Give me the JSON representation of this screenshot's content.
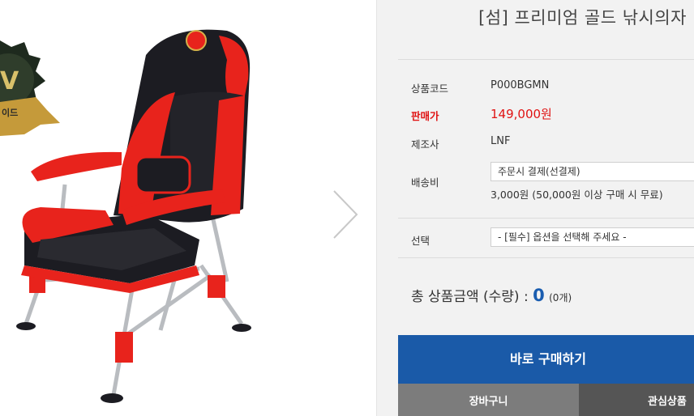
{
  "product": {
    "title": "[섬] 프리미엄 골드 낚시의자",
    "badge_text": "이드"
  },
  "info": {
    "code_label": "상품코드",
    "code_value": "P000BGMN",
    "price_label": "판매가",
    "price_value": "149,000원",
    "maker_label": "제조사",
    "maker_value": "LNF",
    "shipping_label": "배송비",
    "shipping_select": "주문시 결제(선결제)",
    "shipping_note": "3,000원 (50,000원 이상 구매 시 무료)",
    "option_label": "선택",
    "option_select": "- [필수] 옵션을 선택해 주세요 -"
  },
  "total": {
    "label": "총 상품금액 (수량) : ",
    "amount": "0",
    "qty": "(0개)"
  },
  "buttons": {
    "buy": "바로 구매하기",
    "cart": "장바구니",
    "wish": "관심상품"
  },
  "colors": {
    "price_red": "#e01313",
    "buy_blue": "#1a5aa8",
    "total_blue": "#1a5db0",
    "chair_red": "#e8231c",
    "chair_black": "#1c1c22"
  },
  "icons": [
    "award-badge-icon",
    "chevron-right-icon"
  ]
}
